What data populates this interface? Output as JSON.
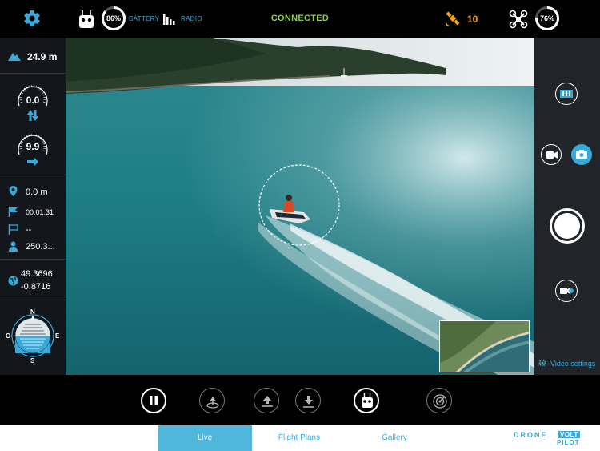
{
  "topbar": {
    "battery_pct": "86%",
    "battery_label": "BATTERY",
    "radio_label": "RADIO",
    "status": "CONNECTED",
    "satellite_count": "10",
    "drone_battery_pct": "76%"
  },
  "telemetry": {
    "altitude": "24.9 m",
    "vertical_speed": "0.0",
    "horizontal_speed": "9.9",
    "distance": "0.0 m",
    "flight_time": "00:01:31",
    "waypoint": "--",
    "pilot_distance": "250.3...",
    "latitude": "49.3696",
    "longitude": "-0.8716"
  },
  "compass": {
    "n": "N",
    "s": "S",
    "e": "E",
    "o": "O"
  },
  "right_panel": {
    "video_settings": "Video settings"
  },
  "nav": {
    "tabs": [
      {
        "label": "Live",
        "active": true
      },
      {
        "label": "Flight Plans",
        "active": false
      },
      {
        "label": "Gallery",
        "active": false
      }
    ]
  },
  "brand": {
    "line1a": "DRONE",
    "line1b": "VOLT",
    "line2": "PILOT"
  },
  "colors": {
    "accent": "#3aa9d8",
    "connected": "#8ccf3d",
    "satellite": "#f5a623"
  }
}
